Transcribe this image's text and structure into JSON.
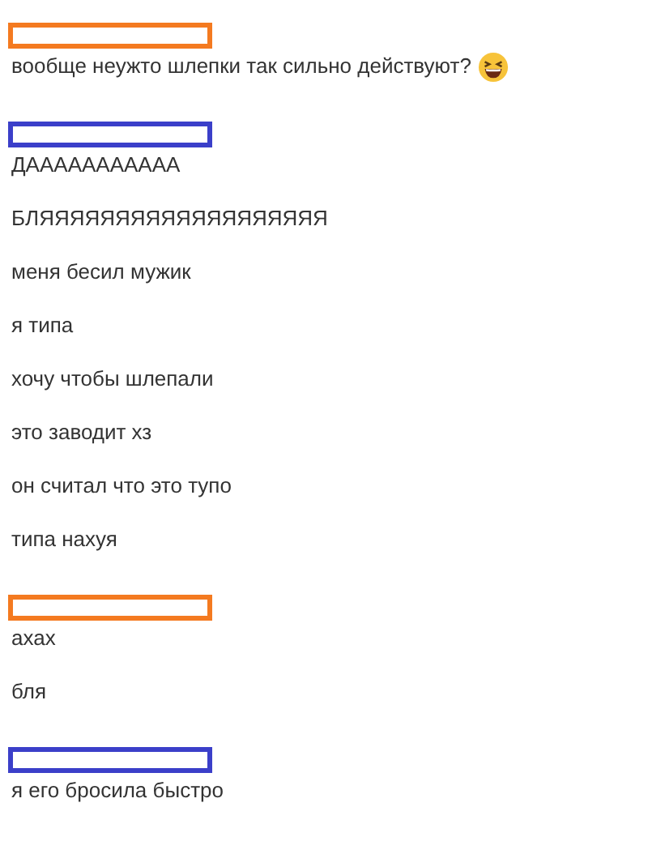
{
  "groups": [
    {
      "color": "#f47a20",
      "messages": [
        {
          "text": "вообще неужто шлепки так сильно действуют?",
          "emoji": true
        }
      ]
    },
    {
      "color": "#3b3fc9",
      "messages": [
        {
          "text": "ДААААААААААА",
          "emoji": false
        },
        {
          "text": "БЛЯЯЯЯЯЯЯЯЯЯЯЯЯЯЯЯЯЯЯ",
          "emoji": false
        },
        {
          "text": "меня бесил мужик",
          "emoji": false
        },
        {
          "text": "я типа",
          "emoji": false
        },
        {
          "text": "хочу чтобы шлепали",
          "emoji": false
        },
        {
          "text": "это заводит хз",
          "emoji": false
        },
        {
          "text": "он считал что это тупо",
          "emoji": false
        },
        {
          "text": "типа нахуя",
          "emoji": false
        }
      ]
    },
    {
      "color": "#f47a20",
      "messages": [
        {
          "text": "ахах",
          "emoji": false
        },
        {
          "text": "бля",
          "emoji": false
        }
      ]
    },
    {
      "color": "#3b3fc9",
      "messages": [
        {
          "text": "я его бросила быстро",
          "emoji": false
        }
      ]
    }
  ]
}
